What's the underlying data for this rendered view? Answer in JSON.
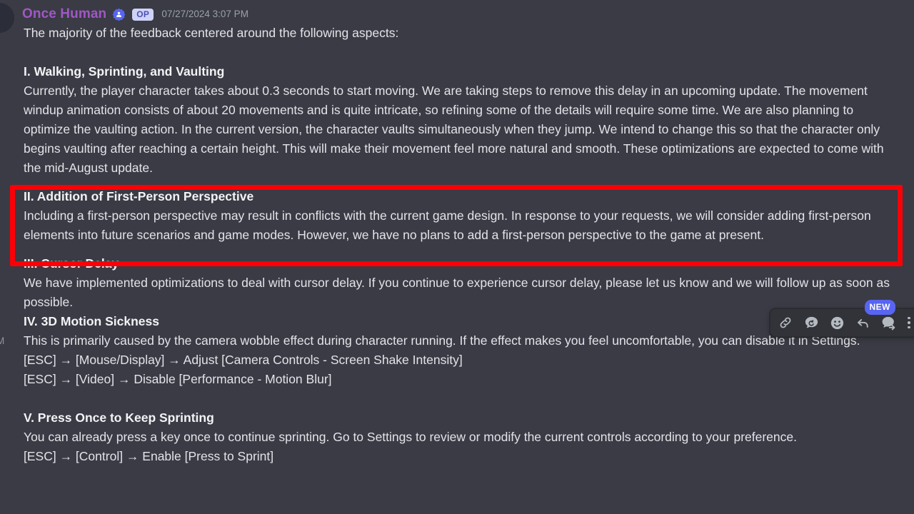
{
  "app": "discord-message-view",
  "theme": {
    "background": "#3a3b45",
    "text": "#e2e4e8",
    "heading": "#f2f3f5",
    "username": "#a057c4",
    "timestamp": "#9aa0a8",
    "accent_blurple": "#5865f2",
    "annotation_red": "#fb0007",
    "toolbar_bg": "#313338"
  },
  "message": {
    "author": "Once Human",
    "verified_badge_icon": "verified-server-icon",
    "op_badge": "OP",
    "timestamp": "07/27/2024 3:07 PM",
    "intro": "The majority of the feedback centered around the following aspects:",
    "sections": [
      {
        "heading": "I. Walking, Sprinting, and Vaulting",
        "body": "Currently, the player character takes about 0.3 seconds to start moving. We are taking steps to remove this delay in an upcoming update. The movement windup animation consists of about 20 movements and is quite intricate, so refining some of the details will require some time. We are also planning to optimize the vaulting action. In the current version, the character vaults simultaneously when they jump. We intend to change this so that the character only begins vaulting after reaching a certain height. This will make their movement feel more natural and smooth. These optimizations are expected to come with the mid-August update."
      },
      {
        "heading": "II. Addition of First-Person Perspective",
        "body": "Including a first-person perspective may result in conflicts with the current game design. In response to your requests, we will consider adding first-person elements into future scenarios and game modes. However, we have no plans to add a first-person perspective to the game at present.",
        "highlighted": true
      },
      {
        "heading": "III. Cursor Delay",
        "body": "We have implemented optimizations to deal with cursor delay. If you continue to experience cursor delay, please let us know and we will follow up as soon as possible."
      },
      {
        "heading": "IV. 3D Motion Sickness",
        "body": "This is primarily caused by the camera wobble effect during character running. If the effect makes you feel uncomfortable, you can disable it in Settings.",
        "steps": [
          "[ESC] → [Mouse/Display] → Adjust [Camera Controls - Screen Shake Intensity]",
          "[ESC] → [Video] → Disable [Performance - Motion Blur]"
        ]
      },
      {
        "heading": "V. Press Once to Keep Sprinting",
        "body": "You can already press a key once to continue sprinting. Go to Settings to review or modify the current controls according to your preference.",
        "steps": [
          "[ESC] → [Control] → Enable [Press to Sprint]"
        ]
      }
    ]
  },
  "compact_timestamp": "PM",
  "hover_toolbar": {
    "new_badge": "NEW",
    "buttons": [
      {
        "name": "copy-link-button",
        "icon": "link-icon"
      },
      {
        "name": "remind-me-button",
        "icon": "message-clock-icon"
      },
      {
        "name": "add-reaction-button",
        "icon": "smiley-icon"
      },
      {
        "name": "reply-button",
        "icon": "reply-arrow-icon"
      },
      {
        "name": "forward-button",
        "icon": "message-forward-icon"
      },
      {
        "name": "more-actions-button",
        "icon": "more-vertical-icon"
      }
    ]
  }
}
